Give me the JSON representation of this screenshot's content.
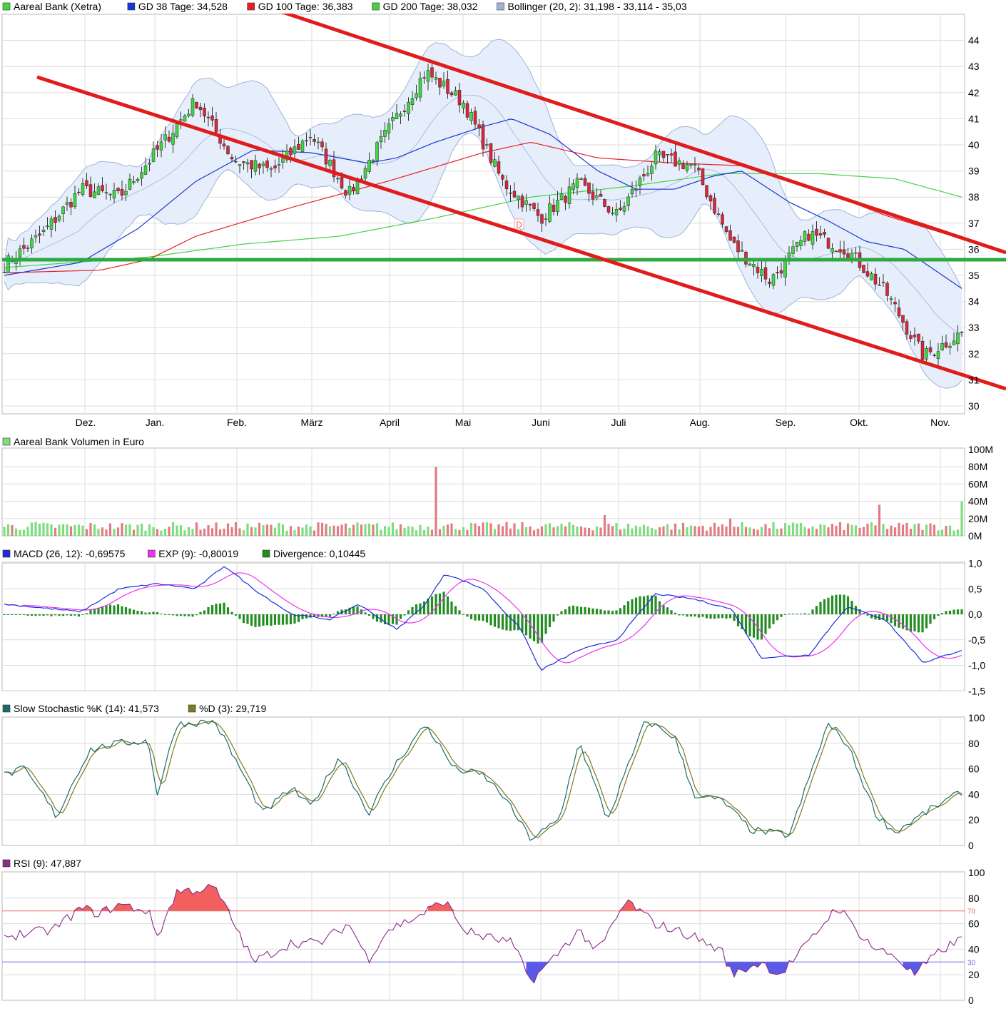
{
  "colors": {
    "grid": "#dcdcdc",
    "frame": "#b8b8b8",
    "text": "#000000",
    "candle_up": "#3ed93e",
    "candle_down": "#d8283a",
    "wick": "#333333",
    "gd38": "#1a35d6",
    "gd100": "#e82020",
    "gd200": "#46d046",
    "boll_fill": "#e6eefb",
    "boll_line": "#9fb2d8",
    "trend_red": "#e01c1c",
    "support_green": "#2ea840",
    "vol_up": "#7fdd7f",
    "vol_down": "#e07c84",
    "vol_neutral": "#bcbcbc",
    "macd": "#1a2fd8",
    "exp": "#ee32ee",
    "divergence": "#238c23",
    "stoch_k": "#1d6b6b",
    "stoch_d": "#7e7a1e",
    "rsi": "#8a2b8a",
    "rsi_over": "#f46060",
    "rsi_under": "#5a5ae8",
    "rsi_line70": "#e86a6a",
    "rsi_line30": "#6b6be8"
  },
  "price_panel": {
    "legend": [
      {
        "label": "Aareal Bank (Xetra)",
        "color": "#3ed93e"
      },
      {
        "label": "GD 38 Tage: 34,528",
        "color": "#1a35d6"
      },
      {
        "label": "GD 100 Tage: 36,383",
        "color": "#e82020"
      },
      {
        "label": "GD 200 Tage: 38,032",
        "color": "#46d046"
      },
      {
        "label": "Bollinger (20, 2): 31,198 - 33,114 - 35,03",
        "color": "#9fb2d8"
      }
    ],
    "y_ticks": [
      "30",
      "31",
      "32",
      "33",
      "34",
      "35",
      "36",
      "37",
      "38",
      "39",
      "40",
      "41",
      "42",
      "43",
      "44"
    ],
    "months": [
      "Dez.",
      "Jan.",
      "Feb.",
      "März",
      "April",
      "Mai",
      "Juni",
      "Juli",
      "Aug.",
      "Sep.",
      "Okt.",
      "Nov."
    ],
    "dividend_marker": "D"
  },
  "volume_panel": {
    "legend": [
      {
        "label": "Aareal Bank Volumen in Euro",
        "color": "#7fdd7f"
      }
    ],
    "y_ticks": [
      "0M",
      "20M",
      "40M",
      "60M",
      "80M",
      "100M"
    ]
  },
  "macd_panel": {
    "legend": [
      {
        "label": "MACD (26, 12): -0,69575",
        "color": "#1a2fd8"
      },
      {
        "label": "EXP (9): -0,80019",
        "color": "#ee32ee"
      },
      {
        "label": "Divergence: 0,10445",
        "color": "#238c23"
      }
    ],
    "y_ticks": [
      "-1,5",
      "-1,0",
      "-0,5",
      "0,0",
      "0,5",
      "1,0"
    ]
  },
  "stoch_panel": {
    "legend": [
      {
        "label": "Slow Stochastic %K (14): 41,573",
        "color": "#1d6b6b"
      },
      {
        "label": "%D (3): 29,719",
        "color": "#7e7a1e"
      }
    ],
    "y_ticks": [
      "0",
      "20",
      "40",
      "60",
      "80",
      "100"
    ]
  },
  "rsi_panel": {
    "legend": [
      {
        "label": "RSI (9): 47,887",
        "color": "#8a2b8a"
      }
    ],
    "y_ticks": [
      "0",
      "20",
      "40",
      "60",
      "80",
      "100"
    ],
    "level_labels": [
      "70",
      "30"
    ]
  },
  "chart_data": [
    {
      "type": "candlestick",
      "title": "Aareal Bank (Xetra)",
      "x_axis": "date",
      "ylim": [
        29.5,
        44.8
      ],
      "grid": true,
      "month_starts": [
        "Dez.",
        "Jan.",
        "Feb.",
        "März",
        "April",
        "Mai",
        "Juni",
        "Juli",
        "Aug.",
        "Sep.",
        "Okt.",
        "Nov."
      ],
      "close_keypoints": [
        [
          "Nov. (start)",
          35.4
        ],
        [
          "Dez.",
          36.6
        ],
        [
          "Dez. (mid)",
          38.3
        ],
        [
          "Jan.",
          38.0
        ],
        [
          "Jan. (mid)",
          39.8
        ],
        [
          "Feb.",
          41.7
        ],
        [
          "Feb. (mid)",
          39.4
        ],
        [
          "März",
          39.0
        ],
        [
          "März (mid)",
          40.4
        ],
        [
          "April",
          38.1
        ],
        [
          "April (mid)",
          40.5
        ],
        [
          "Mai",
          42.8
        ],
        [
          "Mai (mid)",
          41.6
        ],
        [
          "Ende Mai",
          38.6
        ],
        [
          "Juni",
          37.2
        ],
        [
          "Juni (mid)",
          38.5
        ],
        [
          "Juli",
          37.3
        ],
        [
          "Juli (mid)",
          39.5
        ],
        [
          "Aug.",
          39.2
        ],
        [
          "Aug. (mid)",
          36.2
        ],
        [
          "Sep.",
          34.8
        ],
        [
          "Sep. (mid)",
          36.6
        ],
        [
          "Okt.",
          36.0
        ],
        [
          "Okt. (mid)",
          34.4
        ],
        [
          "Ende Okt.",
          31.9
        ],
        [
          "Nov.",
          32.8
        ]
      ],
      "series": [
        {
          "name": "GD 38 Tage",
          "last": 34.528
        },
        {
          "name": "GD 100 Tage",
          "last": 36.383
        },
        {
          "name": "GD 200 Tage",
          "last": 38.032
        },
        {
          "name": "Bollinger (20, 2)",
          "lower": 31.198,
          "middle": 33.114,
          "upper": 35.03
        }
      ],
      "annotations": {
        "upper_trendline": [
          [
            33.8,
            44.8
          ],
          [
            1410,
            35.8
          ]
        ],
        "lower_trendline": [
          [
            52,
            42.7
          ],
          [
            1410,
            30.4
          ]
        ],
        "support_line": 35.6
      }
    },
    {
      "type": "bar",
      "title": "Aareal Bank Volumen in Euro",
      "unit": "M EUR",
      "ylim": [
        0,
        100
      ],
      "peak": 82,
      "typical": [
        5,
        15
      ]
    },
    {
      "type": "line",
      "title": "MACD",
      "ylim": [
        -1.5,
        1.0
      ],
      "series": [
        {
          "name": "MACD (26, 12)",
          "last": -0.69575,
          "keypoints": [
            [
              0,
              0.2
            ],
            [
              0.08,
              0.05
            ],
            [
              0.12,
              0.5
            ],
            [
              0.16,
              0.6
            ],
            [
              0.2,
              0.5
            ],
            [
              0.23,
              0.95
            ],
            [
              0.26,
              0.5
            ],
            [
              0.3,
              0.0
            ],
            [
              0.34,
              -0.1
            ],
            [
              0.37,
              0.2
            ],
            [
              0.41,
              -0.3
            ],
            [
              0.44,
              0.2
            ],
            [
              0.46,
              0.8
            ],
            [
              0.5,
              0.5
            ],
            [
              0.54,
              -0.3
            ],
            [
              0.56,
              -1.1
            ],
            [
              0.6,
              -0.7
            ],
            [
              0.64,
              -0.5
            ],
            [
              0.68,
              0.4
            ],
            [
              0.72,
              0.3
            ],
            [
              0.76,
              0.1
            ],
            [
              0.79,
              -0.85
            ],
            [
              0.84,
              -0.8
            ],
            [
              0.88,
              0.15
            ],
            [
              0.92,
              -0.1
            ],
            [
              0.96,
              -0.95
            ],
            [
              1.0,
              -0.7
            ]
          ]
        },
        {
          "name": "EXP (9)",
          "last": -0.80019
        },
        {
          "name": "Divergence",
          "last": 0.10445
        }
      ]
    },
    {
      "type": "line",
      "title": "Slow Stochastic",
      "ylim": [
        0,
        100
      ],
      "series": [
        {
          "name": "Slow Stochastic %K (14)",
          "last": 41.573
        },
        {
          "name": "%D (3)",
          "last": 29.719
        }
      ]
    },
    {
      "type": "area",
      "title": "RSI (9)",
      "ylim": [
        0,
        100
      ],
      "levels": [
        70,
        30
      ],
      "series": [
        {
          "name": "RSI (9)",
          "last": 47.887
        }
      ]
    }
  ]
}
